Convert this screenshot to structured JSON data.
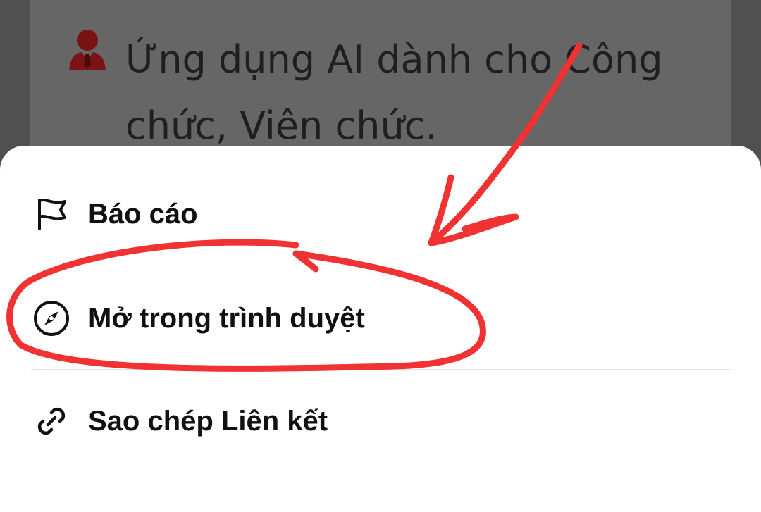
{
  "background": {
    "item_text": "Ứng dụng AI dành cho Công chức, Viên chức.",
    "icon": "person-icon"
  },
  "menu": {
    "items": [
      {
        "label": "Báo cáo",
        "icon": "flag-icon"
      },
      {
        "label": "Mở trong trình duyệt",
        "icon": "compass-icon"
      },
      {
        "label": "Sao chép Liên kết",
        "icon": "link-icon"
      }
    ]
  },
  "colors": {
    "overlay_dim": "#525252",
    "background_card": "#666666",
    "person_icon": "#7a1414",
    "sheet": "#ffffff",
    "annotation": "#f03232"
  }
}
